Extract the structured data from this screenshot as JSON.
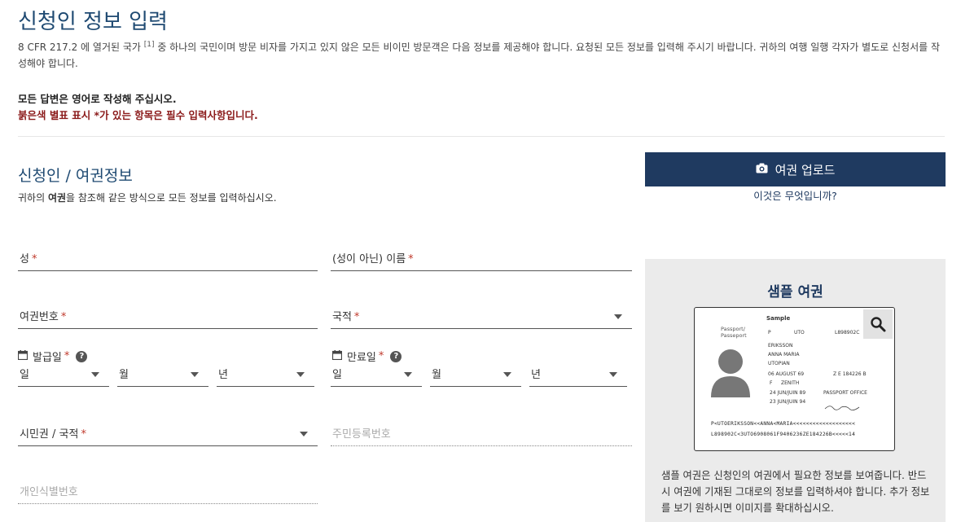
{
  "page": {
    "title": "신청인 정보 입력",
    "intro_a": "8 CFR 217.2 에 열거된 국가 ",
    "intro_sup": "[1]",
    "intro_b": " 중 하나의 국민이며 방문 비자를 가지고 있지 않은 모든 비이민 방문객은 다음 정보를 제공해야 합니다. 요청된 모든 정보를 입력해 주시기 바랍니다. 귀하의 여행 일행 각자가 별도로 신청서를 작성해야 합니다.",
    "note_english": "모든 답변은 영어로 작성해 주십시오.",
    "note_required": "붉은색 별표 표시 *가 있는 항목은 필수 입력사항입니다."
  },
  "section": {
    "title": "신청인 / 여권정보",
    "desc_a": "귀하의 ",
    "desc_bold": "여권",
    "desc_b": "을 참조해 같은 방식으로 모든 정보를 입력하십시오."
  },
  "upload": {
    "button_label": "여권 업로드",
    "what_link": "이것은 무엇입니까?",
    "icon": "camera-icon"
  },
  "form": {
    "required_mark": "*",
    "surname": "성",
    "given_name": "(성이 아닌) 이름",
    "passport_number": "여권번호",
    "nationality": "국적",
    "issue_date": "발급일",
    "expiry_date": "만료일",
    "day": "일",
    "month": "월",
    "year": "년",
    "citizenship": "시민권 / 국적",
    "national_id": "주민등록번호",
    "personal_id": "개인식별번호",
    "help_icon": "?"
  },
  "sample": {
    "title": "샘플 여권",
    "desc": "샘플 여권은 신청인의 여권에서 필요한 정보를 보여줍니다. 반드시 여권에 기재된 그대로의 정보를 입력하셔야 합니다. 추가 정보를 보기 원하시면 이미지를 확대하십시오.",
    "passport": {
      "label_top": "Sample",
      "passport_word": "Passport/",
      "passport_word2": "Passeport",
      "type": "P",
      "code": "UTO",
      "number": "L898902C",
      "surname": "ERIKSSON",
      "given": "ANNA MARIA",
      "nationality": "UTOPIAN",
      "dob": "06 AUGUST 69",
      "personal_no": "Z E 184226 B",
      "sex": "F",
      "place": "ZENITH",
      "issue": "24 JUN/JUIN 89",
      "authority": "PASSPORT OFFICE",
      "expiry": "23 JUN/JUIN 94",
      "mrz1": "P<UTOERIKSSON<<ANNA<MARIA<<<<<<<<<<<<<<<<<<<",
      "mrz2": "L898902C<3UTO6908061F9406236ZE184226B<<<<<14"
    }
  }
}
